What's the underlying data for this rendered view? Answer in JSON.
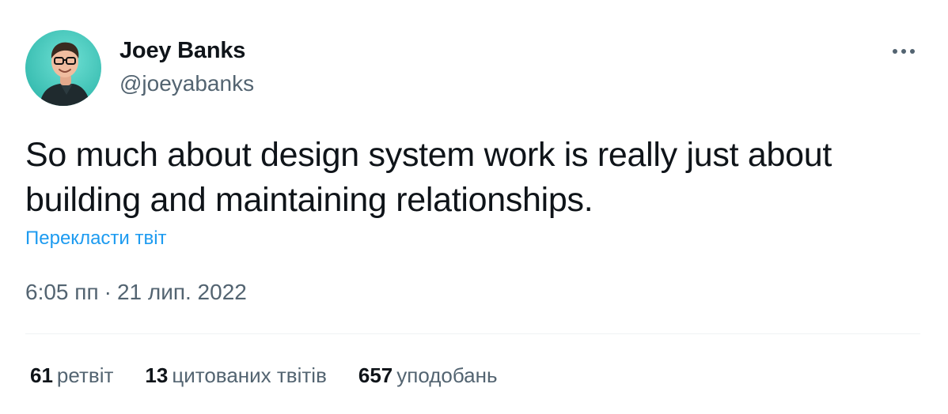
{
  "author": {
    "name": "Joey Banks",
    "handle": "@joeyabanks"
  },
  "tweet": {
    "text": "So much about design system work is really just about building and maintaining relationships.",
    "translate_label": "Перекласти твіт",
    "time": "6:05 пп",
    "separator": "·",
    "date": "21 лип. 2022"
  },
  "stats": [
    {
      "count": "61",
      "label": "ретвіт"
    },
    {
      "count": "13",
      "label": "цитованих твітів"
    },
    {
      "count": "657",
      "label": "уподобань"
    }
  ],
  "icons": {
    "more": "more-horizontal-icon",
    "avatar": "avatar-photo"
  },
  "colors": {
    "text": "#0f1419",
    "secondary": "#536471",
    "link": "#1d9bf0",
    "divider": "#eff3f4",
    "avatar_bg": "#3ec9be"
  }
}
